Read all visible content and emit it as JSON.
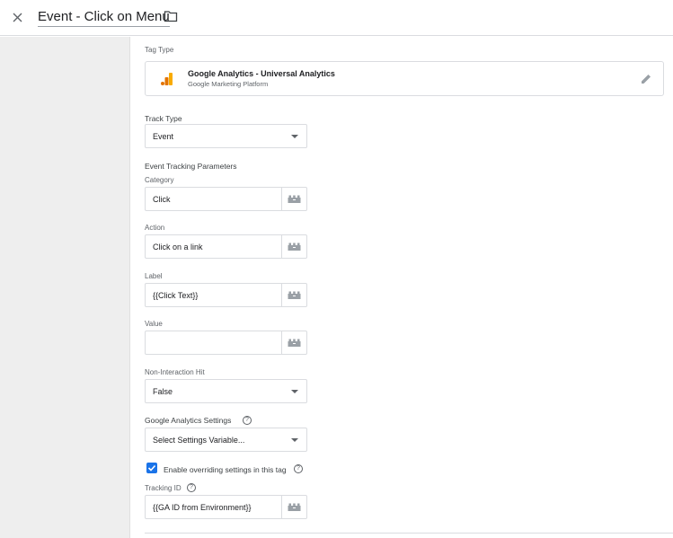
{
  "header": {
    "title": "Event - Click on Menu",
    "close_icon": "close-icon",
    "folder_icon": "folder-icon"
  },
  "tag_type": {
    "label": "Tag Type",
    "name": "Google Analytics - Universal Analytics",
    "subtitle": "Google Marketing Platform",
    "logo_icon": "google-analytics-logo",
    "edit_icon": "pencil-icon",
    "logo_colors": [
      "#f9ab00",
      "#e37400"
    ]
  },
  "track_type": {
    "label": "Track Type",
    "value": "Event"
  },
  "event_params": {
    "heading": "Event Tracking Parameters",
    "category": {
      "label": "Category",
      "value": "Click"
    },
    "action": {
      "label": "Action",
      "value": "Click on a link"
    },
    "label": {
      "label": "Label",
      "value": "{{Click Text}}"
    },
    "value": {
      "label": "Value",
      "value": ""
    },
    "variable_icon": "variable-picker-icon"
  },
  "non_interaction": {
    "label": "Non-Interaction Hit",
    "value": "False"
  },
  "ga_settings": {
    "label": "Google Analytics Settings",
    "value": "Select Settings Variable...",
    "help_icon": "help-icon"
  },
  "override": {
    "label": "Enable overriding settings in this tag",
    "checked": true,
    "checkbox_color": "#1a73e8"
  },
  "tracking_id": {
    "label": "Tracking ID",
    "value": "{{GA ID from Environment}}"
  }
}
